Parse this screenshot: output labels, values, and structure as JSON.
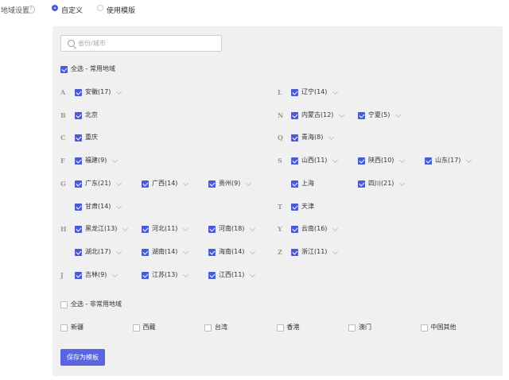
{
  "header": {
    "label": "地域设置",
    "options": [
      {
        "label": "自定义",
        "selected": true
      },
      {
        "label": "使用模版",
        "selected": false
      }
    ]
  },
  "search": {
    "placeholder": "省份/城市",
    "value": ""
  },
  "common_all": {
    "label": "全选 - 常用地域",
    "checked": true
  },
  "groups_left": [
    {
      "letter": "A",
      "rows": [
        [
          {
            "label": "安徽(17)",
            "checked": true,
            "expandable": true
          }
        ]
      ]
    },
    {
      "letter": "B",
      "rows": [
        [
          {
            "label": "北京",
            "checked": true,
            "expandable": false
          }
        ]
      ]
    },
    {
      "letter": "C",
      "rows": [
        [
          {
            "label": "重庆",
            "checked": true,
            "expandable": false
          }
        ]
      ]
    },
    {
      "letter": "F",
      "rows": [
        [
          {
            "label": "福建(9)",
            "checked": true,
            "expandable": true
          }
        ]
      ]
    },
    {
      "letter": "G",
      "rows": [
        [
          {
            "label": "广东(21)",
            "checked": true,
            "expandable": true
          },
          {
            "label": "广西(14)",
            "checked": true,
            "expandable": true
          },
          {
            "label": "贵州(9)",
            "checked": true,
            "expandable": true
          }
        ],
        [
          {
            "label": "甘肃(14)",
            "checked": true,
            "expandable": true
          }
        ]
      ]
    },
    {
      "letter": "H",
      "rows": [
        [
          {
            "label": "黑龙江(13)",
            "checked": true,
            "expandable": true
          },
          {
            "label": "河北(11)",
            "checked": true,
            "expandable": true
          },
          {
            "label": "河南(18)",
            "checked": true,
            "expandable": true
          }
        ],
        [
          {
            "label": "湖北(17)",
            "checked": true,
            "expandable": true
          },
          {
            "label": "湖南(14)",
            "checked": true,
            "expandable": true
          },
          {
            "label": "海南(14)",
            "checked": true,
            "expandable": true
          }
        ]
      ]
    },
    {
      "letter": "J",
      "rows": [
        [
          {
            "label": "吉林(9)",
            "checked": true,
            "expandable": true
          },
          {
            "label": "江苏(13)",
            "checked": true,
            "expandable": true
          },
          {
            "label": "江西(11)",
            "checked": true,
            "expandable": true
          }
        ]
      ]
    }
  ],
  "groups_right": [
    {
      "letter": "L",
      "rows": [
        [
          {
            "label": "辽宁(14)",
            "checked": true,
            "expandable": true
          }
        ]
      ]
    },
    {
      "letter": "N",
      "rows": [
        [
          {
            "label": "内蒙古(12)",
            "checked": true,
            "expandable": true
          },
          {
            "label": "宁夏(5)",
            "checked": true,
            "expandable": true
          }
        ]
      ]
    },
    {
      "letter": "Q",
      "rows": [
        [
          {
            "label": "青海(8)",
            "checked": true,
            "expandable": true
          }
        ]
      ]
    },
    {
      "letter": "S",
      "rows": [
        [
          {
            "label": "山西(11)",
            "checked": true,
            "expandable": true
          },
          {
            "label": "陕西(10)",
            "checked": true,
            "expandable": true
          },
          {
            "label": "山东(17)",
            "checked": true,
            "expandable": true
          }
        ],
        [
          {
            "label": "上海",
            "checked": true,
            "expandable": false
          },
          {
            "label": "四川(21)",
            "checked": true,
            "expandable": true
          }
        ]
      ]
    },
    {
      "letter": "T",
      "rows": [
        [
          {
            "label": "天津",
            "checked": true,
            "expandable": false
          }
        ]
      ]
    },
    {
      "letter": "Y",
      "rows": [
        [
          {
            "label": "云南(16)",
            "checked": true,
            "expandable": true
          }
        ]
      ]
    },
    {
      "letter": "Z",
      "rows": [
        [
          {
            "label": "浙江(11)",
            "checked": true,
            "expandable": true
          }
        ]
      ]
    }
  ],
  "uncommon_all": {
    "label": "全选 - 非常用地域",
    "checked": false
  },
  "uncommon": [
    {
      "label": "新疆",
      "checked": false
    },
    {
      "label": "西藏",
      "checked": false
    },
    {
      "label": "台湾",
      "checked": false
    },
    {
      "label": "香港",
      "checked": false
    },
    {
      "label": "澳门",
      "checked": false
    },
    {
      "label": "中国其他",
      "checked": false
    }
  ],
  "save_button": "保存为模板"
}
